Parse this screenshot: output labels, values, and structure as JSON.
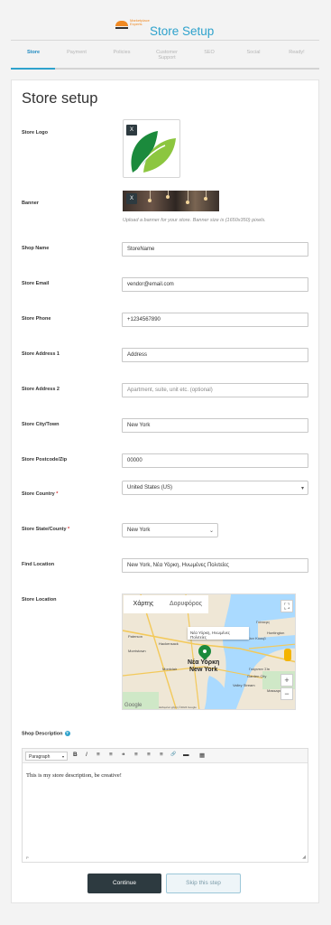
{
  "header": {
    "title": "Store Setup",
    "logo_text": "Marketplace Experts"
  },
  "steps": [
    "Store",
    "Payment",
    "Policies",
    "Customer Support",
    "SEO",
    "Social",
    "Ready!"
  ],
  "page_title": "Store setup",
  "labels": {
    "logo": "Store Logo",
    "banner": "Banner",
    "shop_name": "Shop Name",
    "email": "Store Email",
    "phone": "Store Phone",
    "address1": "Store Address 1",
    "address2": "Store Address 2",
    "city": "Store City/Town",
    "postcode": "Store Postcode/Zip",
    "country": "Store Country",
    "state": "Store State/County",
    "find_location": "Find Location",
    "store_location": "Store Location",
    "description": "Shop Description"
  },
  "required_marker": "*",
  "image_remove_label": "X",
  "banner_hint": "Upload a banner for your store. Banner size is (1650x350) pixels.",
  "fields": {
    "shop_name": "StoreName",
    "email": "vendor@email.com",
    "phone": "+1234567890",
    "address1": "Address",
    "address2_placeholder": "Apartment, suite, unit etc. (optional)",
    "city": "New York",
    "postcode": "00000",
    "country": "United States (US)",
    "state": "New York",
    "find_location": "New York, Νέα Υόρκη, Ηνωμένες Πολιτείες"
  },
  "map": {
    "tab_map": "Χάρτης",
    "tab_satellite": "Δορυφόρος",
    "popup": "Νέα Υόρκη, Ηνωμένες Πολιτείες",
    "center_label_1": "Νέα Υόρκη",
    "center_label_2": "New York",
    "places": [
      "Γιόνκερς",
      "Paterson",
      "Hackensack",
      "Morristown",
      "Montclair",
      "Huntington",
      "Garden City",
      "Γκλεν Κόουβ",
      "Valley Stream",
      "Massapequa",
      "Γκάρντεν Σίτι"
    ],
    "google": "Google",
    "attribution": "Δεδομένα χάρτη ©2024 Google"
  },
  "editor": {
    "paragraph": "Paragraph",
    "content": "This is my store description, be creative!",
    "status": "P",
    "tools": [
      "B",
      "I",
      "≡",
      "≡",
      "❝",
      "≡",
      "≡",
      "≡",
      "🔗",
      "▬",
      "▦"
    ]
  },
  "buttons": {
    "continue": "Continue",
    "skip": "Skip this step"
  },
  "colors": {
    "accent": "#2ea2cc",
    "primary_button": "#2d3a40",
    "pin": "#1b8a3c"
  }
}
